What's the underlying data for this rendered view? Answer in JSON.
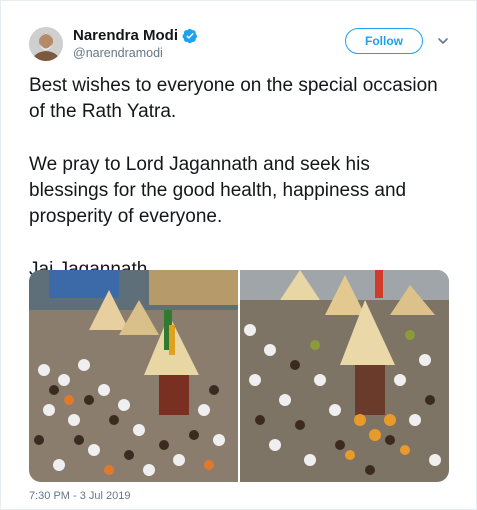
{
  "author": {
    "name": "Narendra Modi",
    "handle": "@narendramodi",
    "verified": true,
    "avatar_icon": "avatar-portrait"
  },
  "actions": {
    "follow_label": "Follow",
    "more_icon": "chevron-down-icon"
  },
  "tweet": {
    "paragraphs": [
      "Best wishes to everyone on the special occasion of the Rath Yatra.",
      "We pray to Lord Jagannath and seek his blessings for the good health, happiness and prosperity of everyone.",
      "Jai Jagannath."
    ]
  },
  "media": {
    "photos": [
      "rath-yatra-crowd-photo-1",
      "rath-yatra-crowd-photo-2"
    ]
  },
  "meta": {
    "timestamp": "7:30 PM - 3 Jul 2019"
  },
  "colors": {
    "accent": "#1da1f2",
    "text": "#14171a",
    "secondary": "#657786"
  }
}
